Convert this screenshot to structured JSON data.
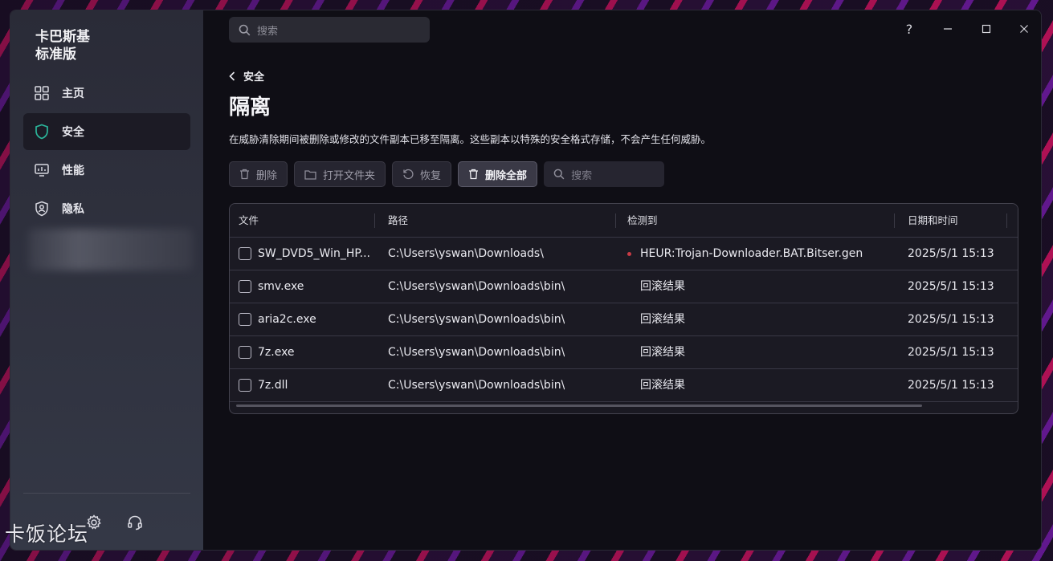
{
  "app": {
    "brand_line1": "卡巴斯基",
    "brand_line2": "标准版"
  },
  "sidebar": {
    "items": [
      {
        "label": "主页",
        "icon": "home-grid-icon",
        "active": false
      },
      {
        "label": "安全",
        "icon": "shield-icon",
        "active": true
      },
      {
        "label": "性能",
        "icon": "monitor-icon",
        "active": false
      },
      {
        "label": "隐私",
        "icon": "privacy-shield-icon",
        "active": false
      }
    ],
    "footer_icons": [
      "gear-icon",
      "headset-icon"
    ]
  },
  "topbar": {
    "search_placeholder": "搜索",
    "help": "?"
  },
  "page": {
    "back_label": "安全",
    "title": "隔离",
    "description": "在威胁清除期间被删除或修改的文件副本已移至隔离。这些副本以特殊的安全格式存储，不会产生任何威胁。"
  },
  "toolbar": {
    "delete": "删除",
    "open_folder": "打开文件夹",
    "restore": "恢复",
    "delete_all": "删除全部",
    "search_placeholder": "搜索"
  },
  "table": {
    "headers": [
      "文件",
      "路径",
      "检测到",
      "日期和时间"
    ],
    "rows": [
      {
        "file": "SW_DVD5_Win_HP...",
        "path": "C:\\Users\\yswan\\Downloads\\",
        "detected": "HEUR:Trojan-Downloader.BAT.Bitser.gen",
        "datetime": "2025/5/1 15:13",
        "threat": true
      },
      {
        "file": "smv.exe",
        "path": "C:\\Users\\yswan\\Downloads\\bin\\",
        "detected": "回滚结果",
        "datetime": "2025/5/1 15:13",
        "threat": false
      },
      {
        "file": "aria2c.exe",
        "path": "C:\\Users\\yswan\\Downloads\\bin\\",
        "detected": "回滚结果",
        "datetime": "2025/5/1 15:13",
        "threat": false
      },
      {
        "file": "7z.exe",
        "path": "C:\\Users\\yswan\\Downloads\\bin\\",
        "detected": "回滚结果",
        "datetime": "2025/5/1 15:13",
        "threat": false
      },
      {
        "file": "7z.dll",
        "path": "C:\\Users\\yswan\\Downloads\\bin\\",
        "detected": "回滚结果",
        "datetime": "2025/5/1 15:13",
        "threat": false
      }
    ]
  },
  "watermark": "卡饭论坛",
  "colors": {
    "threat_dot": "#c83b45",
    "active_nav_bg": "#1c1b25",
    "shield_accent": "#2bb59a"
  }
}
